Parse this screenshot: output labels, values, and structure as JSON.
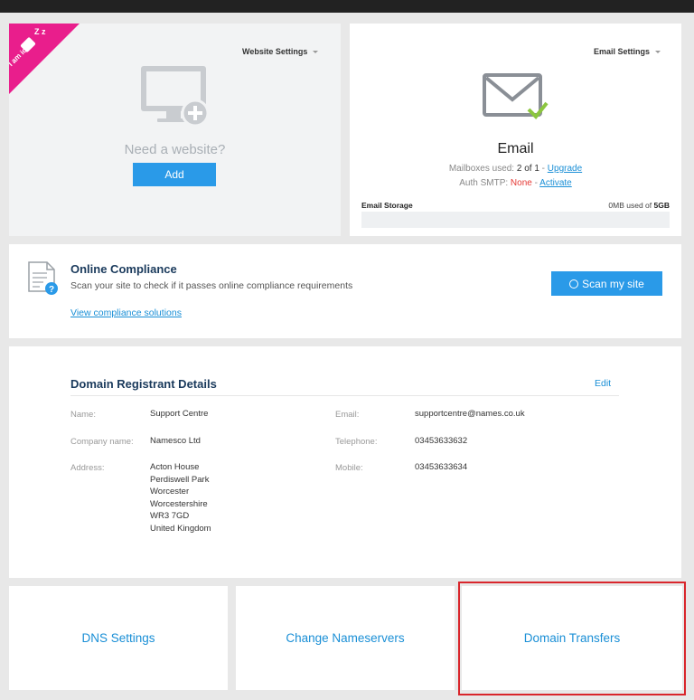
{
  "website": {
    "settings_label": "Website Settings",
    "idle_ribbon": "I am idle",
    "idle_zz": "Z z",
    "need_text": "Need a website?",
    "add_label": "Add"
  },
  "email": {
    "settings_label": "Email Settings",
    "title": "Email",
    "mailboxes_label": "Mailboxes used:",
    "mailboxes_value": "2 of 1",
    "mailboxes_sep": " - ",
    "upgrade_label": "Upgrade",
    "smtp_label": "Auth SMTP:",
    "smtp_value": "None",
    "smtp_sep": " - ",
    "activate_label": "Activate",
    "storage_label": "Email Storage",
    "storage_used": "0MB used of",
    "storage_total": "5GB",
    "storage_fraction": 0
  },
  "compliance": {
    "title": "Online Compliance",
    "description": "Scan your site to check if it passes online compliance requirements",
    "link_label": "View compliance solutions",
    "scan_label": "Scan my site"
  },
  "registrant": {
    "title": "Domain Registrant Details",
    "edit_label": "Edit",
    "name_label": "Name:",
    "name_value": "Support Centre",
    "company_label": "Company name:",
    "company_value": "Namesco Ltd",
    "address_label": "Address:",
    "address_lines": [
      "Acton House",
      "Perdiswell Park",
      "Worcester",
      "Worcestershire",
      "WR3 7GD",
      "United Kingdom"
    ],
    "email_label": "Email:",
    "email_value": "supportcentre@names.co.uk",
    "telephone_label": "Telephone:",
    "telephone_value": "03453633632",
    "mobile_label": "Mobile:",
    "mobile_value": "03453633634"
  },
  "tiles": {
    "dns": "DNS Settings",
    "nameservers": "Change Nameservers",
    "transfers": "Domain Transfers"
  },
  "colors": {
    "accent": "#2a9ae8",
    "ribbon": "#e91e8c",
    "highlight": "#d9262c",
    "check": "#8cc63f"
  }
}
